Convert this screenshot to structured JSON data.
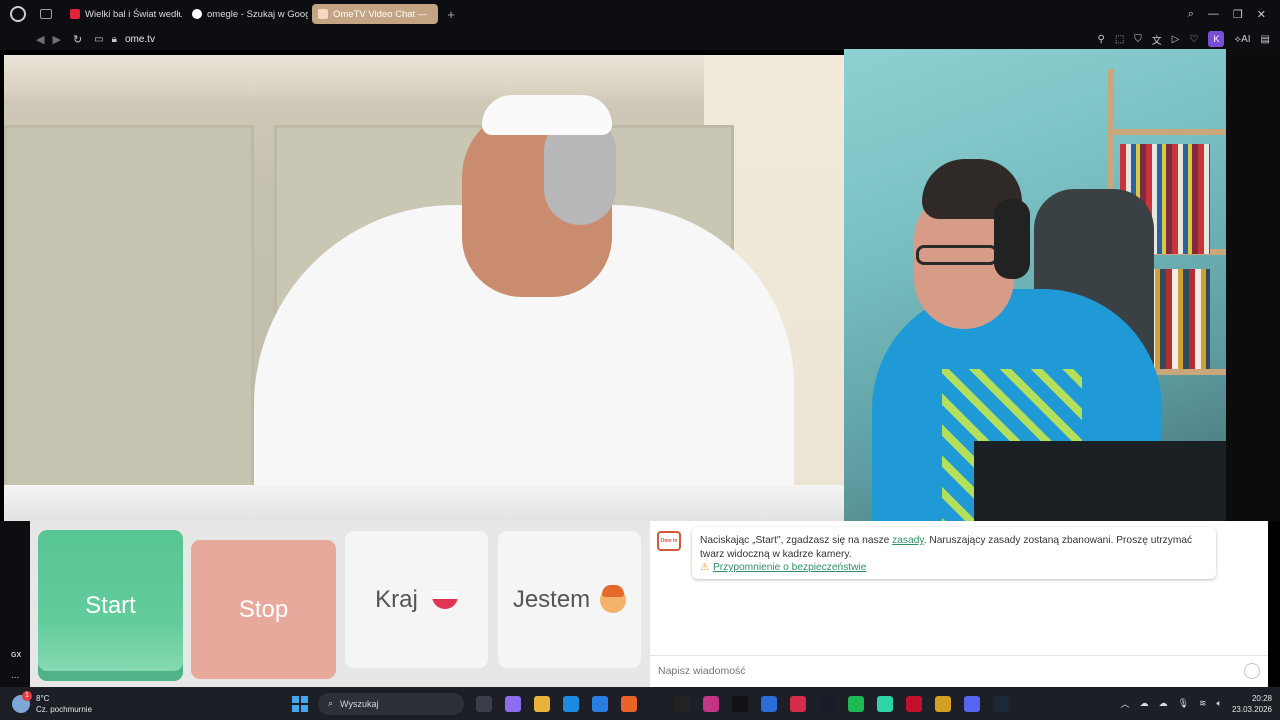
{
  "browser": {
    "tabs": [
      {
        "label": "Wielki bal i Świat według K",
        "favicon_color": "#e0243a"
      },
      {
        "label": "omegle - Szukaj w Google",
        "favicon_color": "#ffffff"
      },
      {
        "label": "OmeTV Video Chat —",
        "favicon_color": "#f5d7c2"
      }
    ],
    "new_tab": "+",
    "url": "ome.tv",
    "profile_badge": "K",
    "ai_label": "AI"
  },
  "controls": {
    "start": "Start",
    "stop": "Stop",
    "country": "Kraj",
    "iam": "Jestem"
  },
  "chat": {
    "logo": "Ome tv",
    "notice_pre": "Naciskając „Start\", zgadzasz się na nasze ",
    "notice_link": "zasady",
    "notice_post": ". Naruszający zasady zostaną zbanowani. Proszę utrzymać twarz widoczną w kadrze kamery.",
    "safety_link": "Przypomnienie o bezpieczeństwie",
    "input_placeholder": "Napisz wiadomość"
  },
  "sidebar": {
    "gx": "GX",
    "more": "..."
  },
  "taskbar": {
    "weather_temp": "8°C",
    "weather_desc": "Cz. pochmurnie",
    "weather_badge": "1",
    "search_placeholder": "Wyszukaj",
    "time": "20:28",
    "date": "23.03.2026",
    "apps": [
      "#3a3f49",
      "#8e6cf0",
      "#e8b43a",
      "#1f8be0",
      "#2a7de1",
      "#e8642a",
      "#222222",
      "#c13584",
      "#111111",
      "#2b6cd6",
      "#d62b4a",
      "#1b1b2b",
      "#1db954",
      "#2dd4a8",
      "#c0102a",
      "#d4a020",
      "#5865f2",
      "#1b2838"
    ]
  }
}
